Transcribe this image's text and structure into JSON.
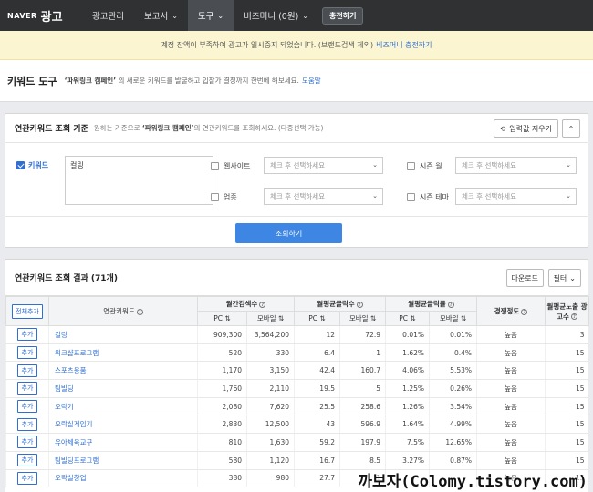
{
  "nav": {
    "logo_naver": "NAVER",
    "logo_ad": "광고",
    "items": [
      "광고관리",
      "보고서",
      "도구",
      "비즈머니 (0원)"
    ],
    "charge_label": "충전하기"
  },
  "alert": {
    "text": "계정 잔액이 부족하여 광고가 일시중지 되었습니다. (브랜드검색 제외)",
    "link": "비즈머니 충전하기"
  },
  "page": {
    "title": "키워드 도구",
    "desc_prefix": "‘파워링크 캠페인’",
    "desc_text": "의 새로운 키워드를 발굴하고 입찰가 결정까지 한번에 해보세요.",
    "help": "도움말"
  },
  "criteria": {
    "title": "연관키워드 조회 기준",
    "desc_pre": "원하는 기준으로",
    "desc_bold": "‘파워링크 캠페인’",
    "desc_post": "의 연관키워드를 조회하세요. (다중선택 가능)",
    "reset_label": "입력값 지우기",
    "keyword_label": "키워드",
    "keyword_value": "컬링",
    "website_label": "웹사이트",
    "industry_label": "업종",
    "season_month_label": "시즌 월",
    "season_theme_label": "시즌 테마",
    "select_placeholder": "체크 후 선택하세요",
    "search_label": "조회하기"
  },
  "results": {
    "title": "연관키워드 조회 결과 (71개)",
    "download_label": "다운로드",
    "filter_label": "필터",
    "headers": {
      "add_all": "전체추가",
      "keyword": "연관키워드",
      "monthly_search": "월간검색수",
      "avg_clicks": "월평균클릭수",
      "avg_ctr": "월평균클릭률",
      "competition": "경쟁정도",
      "avg_ads": "월평균노출 광고수",
      "pc": "PC",
      "mobile": "모바일"
    },
    "add_label": "추가",
    "rows": [
      {
        "kw": "컬링",
        "s_pc": "909,300",
        "s_mo": "3,564,200",
        "c_pc": "12",
        "c_mo": "72.9",
        "r_pc": "0.01%",
        "r_mo": "0.01%",
        "comp": "높음",
        "ads": "3"
      },
      {
        "kw": "워크샵프로그램",
        "s_pc": "520",
        "s_mo": "330",
        "c_pc": "6.4",
        "c_mo": "1",
        "r_pc": "1.62%",
        "r_mo": "0.4%",
        "comp": "높음",
        "ads": "15"
      },
      {
        "kw": "스포츠용품",
        "s_pc": "1,170",
        "s_mo": "3,150",
        "c_pc": "42.4",
        "c_mo": "160.7",
        "r_pc": "4.06%",
        "r_mo": "5.53%",
        "comp": "높음",
        "ads": "15"
      },
      {
        "kw": "팀빌딩",
        "s_pc": "1,760",
        "s_mo": "2,110",
        "c_pc": "19.5",
        "c_mo": "5",
        "r_pc": "1.25%",
        "r_mo": "0.26%",
        "comp": "높음",
        "ads": "15"
      },
      {
        "kw": "오락기",
        "s_pc": "2,080",
        "s_mo": "7,620",
        "c_pc": "25.5",
        "c_mo": "258.6",
        "r_pc": "1.26%",
        "r_mo": "3.54%",
        "comp": "높음",
        "ads": "15"
      },
      {
        "kw": "오락실게임기",
        "s_pc": "2,830",
        "s_mo": "12,500",
        "c_pc": "43",
        "c_mo": "596.9",
        "r_pc": "1.64%",
        "r_mo": "4.99%",
        "comp": "높음",
        "ads": "15"
      },
      {
        "kw": "유아체육교구",
        "s_pc": "810",
        "s_mo": "1,630",
        "c_pc": "59.2",
        "c_mo": "197.9",
        "r_pc": "7.5%",
        "r_mo": "12.65%",
        "comp": "높음",
        "ads": "15"
      },
      {
        "kw": "팀빌딩프로그램",
        "s_pc": "580",
        "s_mo": "1,120",
        "c_pc": "16.7",
        "c_mo": "8.5",
        "r_pc": "3.27%",
        "r_mo": "0.87%",
        "comp": "높음",
        "ads": "15"
      },
      {
        "kw": "오락실창업",
        "s_pc": "380",
        "s_mo": "980",
        "c_pc": "27.7",
        "c_mo": "1",
        "r_pc": "",
        "r_mo": "",
        "comp": "높음",
        "ads": "15"
      }
    ]
  },
  "watermark": "까보자(Colomy.tistory.com)",
  "colors": {
    "accent": "#2f6fd3",
    "nav_bg": "#2f3133",
    "alert_bg": "#fbf6d1",
    "button_primary": "#3d86e4"
  }
}
